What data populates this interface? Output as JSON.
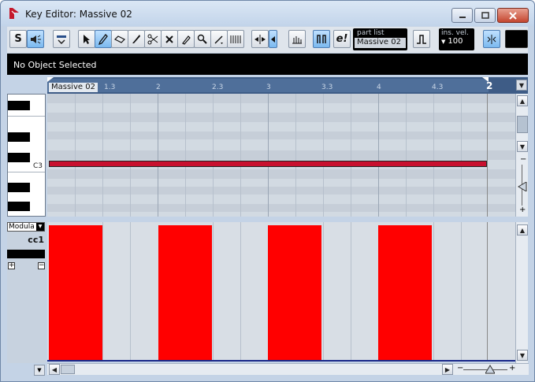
{
  "window": {
    "title": "Key Editor: Massive 02"
  },
  "toolbar": {
    "solo_label": "S",
    "edit_label": "e!",
    "part_list_label": "part list",
    "part_list_value": "Massive 02",
    "ins_vel_label": "ins. vel.",
    "ins_vel_value": "100"
  },
  "info_bar": {
    "status": "No Object Selected"
  },
  "ruler": {
    "part_name": "Massive 02",
    "ticks": [
      "1.3",
      "2",
      "2.3",
      "3",
      "3.3",
      "4",
      "4.3",
      "2"
    ]
  },
  "keyboard": {
    "note_label": "C3"
  },
  "controller": {
    "lane_select": "Modula",
    "cc_label": "cc1",
    "bar_values": [
      1.0,
      1.0,
      1.0,
      1.0
    ]
  },
  "colors": {
    "note": "#c8102e",
    "controller_bar": "#ff0000",
    "ruler_bg": "#3e5c86"
  }
}
